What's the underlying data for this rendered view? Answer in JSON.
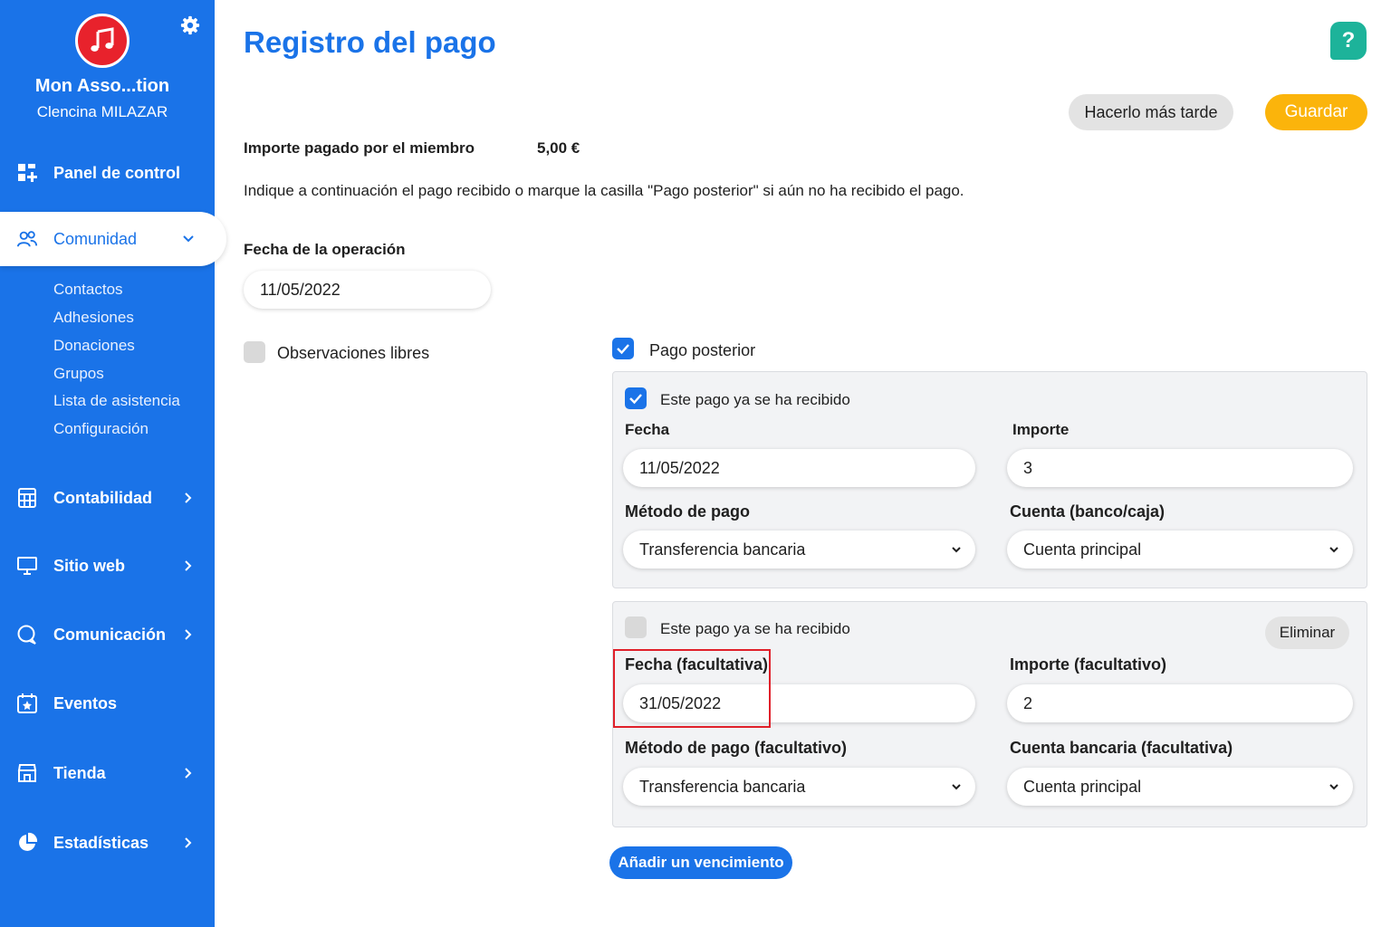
{
  "sidebar": {
    "org_name": "Mon Asso...tion",
    "user_name": "Clencina MILAZAR",
    "nav": {
      "dashboard": "Panel de control",
      "community": "Comunidad",
      "accounting": "Contabilidad",
      "website": "Sitio web",
      "communication": "Comunicación",
      "events": "Eventos",
      "shop": "Tienda",
      "stats": "Estadísticas"
    },
    "community_sub": [
      "Contactos",
      "Adhesiones",
      "Donaciones",
      "Grupos",
      "Lista de asistencia",
      "Configuración"
    ]
  },
  "header": {
    "title": "Registro del pago",
    "help": "?",
    "later_button": "Hacerlo más tarde",
    "save_button": "Guardar"
  },
  "summary": {
    "amount_label": "Importe pagado por el miembro",
    "amount_value": "5,00 €",
    "instructions": "Indique a continuación el pago recibido o marque la casilla \"Pago posterior\" si aún no ha recibido el pago."
  },
  "operation": {
    "date_label": "Fecha de la operación",
    "date_value": "11/05/2022",
    "notes_label": "Observaciones libres",
    "notes_checked": false
  },
  "deferred": {
    "label": "Pago posterior",
    "checked": true
  },
  "installment1": {
    "received_label": "Este pago ya se ha recibido",
    "received_checked": true,
    "date_label": "Fecha",
    "date_value": "11/05/2022",
    "amount_label": "Importe",
    "amount_value": "3",
    "method_label": "Método de pago",
    "method_value": "Transferencia bancaria",
    "account_label": "Cuenta (banco/caja)",
    "account_value": "Cuenta principal"
  },
  "installment2": {
    "received_label": "Este pago ya se ha recibido",
    "received_checked": false,
    "delete_button": "Eliminar",
    "date_label": "Fecha (facultativa)",
    "date_value": "31/05/2022",
    "amount_label": "Importe (facultativo)",
    "amount_value": "2",
    "method_label": "Método de pago (facultativo)",
    "method_value": "Transferencia bancaria",
    "account_label": "Cuenta bancaria (facultativa)",
    "account_value": "Cuenta principal"
  },
  "add_installment_button": "Añadir un vencimiento",
  "colors": {
    "primary": "#1a73e8",
    "accent": "#fbb40b",
    "help": "#1db39a",
    "logo": "#e8222c",
    "highlight": "#e0202a"
  }
}
